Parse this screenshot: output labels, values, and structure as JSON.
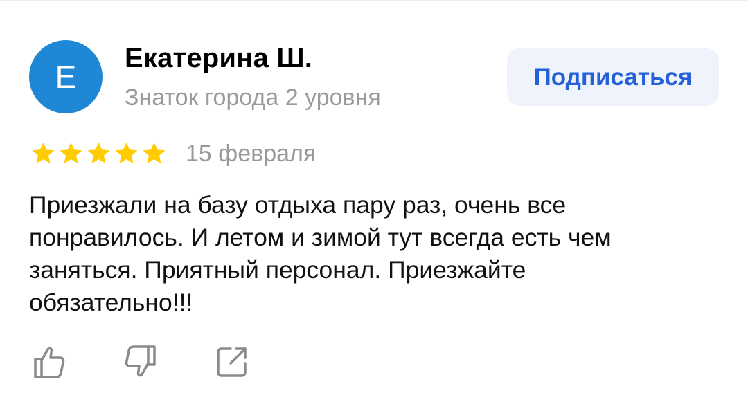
{
  "author": {
    "avatar_letter": "Е",
    "avatar_color": "#1e88d6",
    "name": "Екатерина Ш.",
    "level": "Знаток города 2 уровня"
  },
  "subscribe": {
    "label": "Подписаться",
    "text_color": "#2461d9",
    "bg_color": "#eff3fc"
  },
  "review": {
    "rating": 5,
    "rating_max": 5,
    "star_color": "#ffcc00",
    "date": "15 февраля",
    "text": "Приезжали на базу отдыха пару раз, очень все понравилось. И летом и зимой тут всегда есть чем заняться. Приятный персонал. Приезжайте обязательно!!!"
  },
  "actions": [
    {
      "icon": "thumbs-up-icon"
    },
    {
      "icon": "thumbs-down-icon"
    },
    {
      "icon": "share-icon"
    }
  ],
  "icon_color": "#8a8a8a"
}
